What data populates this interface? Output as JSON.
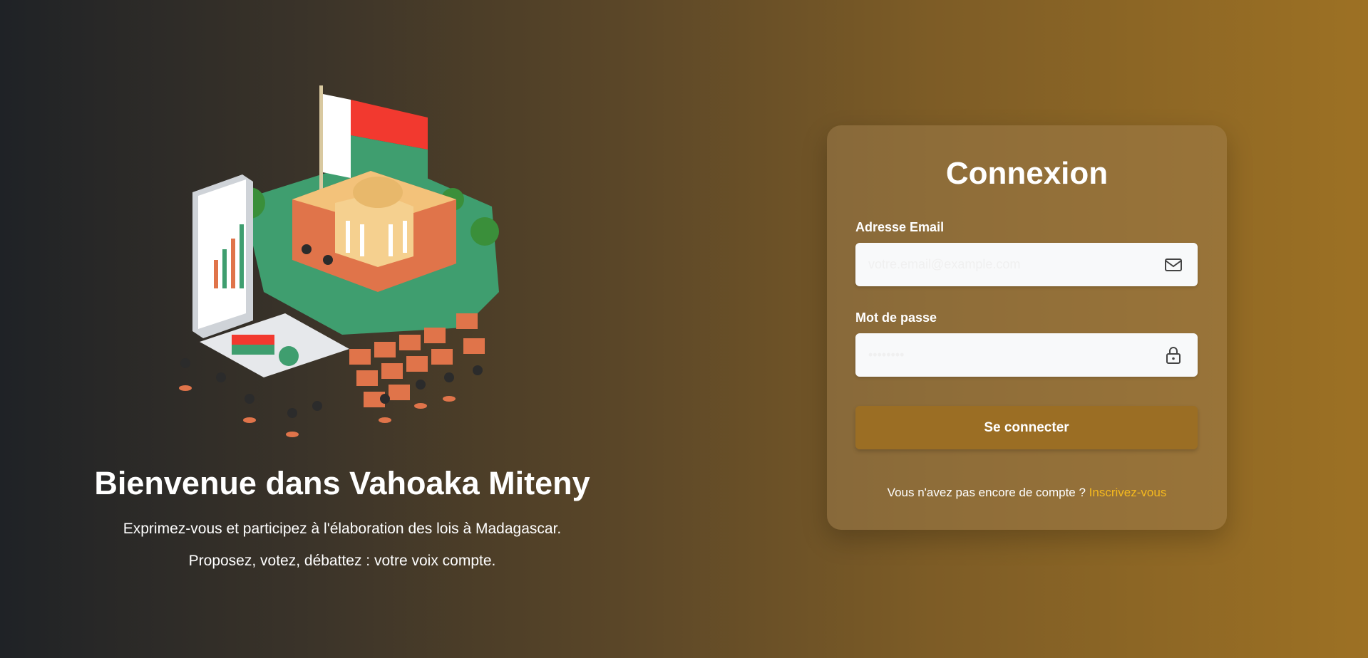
{
  "hero": {
    "title": "Bienvenue dans Vahoaka Miteny",
    "subtitle_1": "Exprimez-vous et participez à l'élaboration des lois à Madagascar.",
    "subtitle_2": "Proposez, votez, débattez : votre voix compte.",
    "illustration_icon": "madagascar-parliament-illustration"
  },
  "login": {
    "title": "Connexion",
    "email_label": "Adresse Email",
    "email_placeholder": "votre.email@example.com",
    "email_icon": "envelope-icon",
    "password_label": "Mot de passe",
    "password_placeholder": "••••••••",
    "password_icon": "lock-icon",
    "submit_label": "Se connecter",
    "signup_prompt": "Vous n'avez pas encore de compte ?",
    "signup_link": "Inscrivez-vous"
  },
  "colors": {
    "button": "#9b6e24",
    "link": "#f5b91e",
    "flag_red": "#f2392f",
    "flag_green": "#3f9e6f"
  }
}
